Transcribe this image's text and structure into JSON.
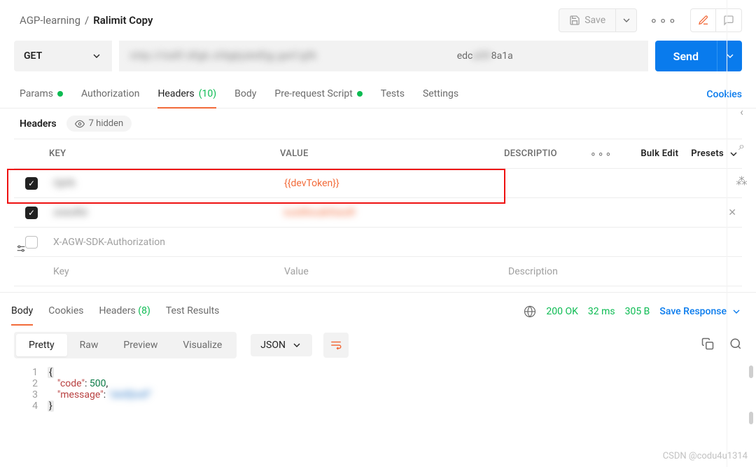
{
  "breadcrumb": {
    "workspace": "AGP-learning",
    "sep": "/",
    "request": "Ralimit Copy"
  },
  "top": {
    "save": "Save"
  },
  "request": {
    "method": "GET",
    "url_obscured_prefix": "nttp://lsdlf.dfgk.sfdgkjskdfjg.gwf/gfk",
    "url_clear_mid": "edc",
    "url_obscured_suffix": "a59",
    "url_clear_tail": "8a1a",
    "send": "Send"
  },
  "tabs": {
    "params": "Params",
    "authorization": "Authorization",
    "headers_label": "Headers",
    "headers_count": "(10)",
    "body": "Body",
    "pre_request": "Pre-request Script",
    "tests": "Tests",
    "settings": "Settings",
    "cookies": "Cookies"
  },
  "headers_sub": {
    "label": "Headers",
    "hidden": "7 hidden"
  },
  "grid_head": {
    "key": "KEY",
    "value": "VALUE",
    "description": "DESCRIPTIO",
    "bulk_edit": "Bulk Edit",
    "presets": "Presets"
  },
  "rows": [
    {
      "key_obscured": "Gjkfk",
      "value": "{{devToken}}",
      "checked": true
    },
    {
      "key_obscured": "slskdfld",
      "value_obscured": "ksldfklsdkflskdfl",
      "checked": true,
      "closable": true
    },
    {
      "key": "X-AGW-SDK-Authorization",
      "value": "",
      "checked": false
    }
  ],
  "placeholder_row": {
    "key": "Key",
    "value": "Value",
    "description": "Description"
  },
  "response_tabs": {
    "body": "Body",
    "cookies": "Cookies",
    "headers": "Headers",
    "headers_count": "(8)",
    "test_results": "Test Results"
  },
  "status": {
    "code": "200 OK",
    "time": "32 ms",
    "size": "305 B",
    "save_response": "Save Response"
  },
  "view": {
    "pretty": "Pretty",
    "raw": "Raw",
    "preview": "Preview",
    "visualize": "Visualize",
    "format": "JSON"
  },
  "code": {
    "lines": [
      "1",
      "2",
      "3",
      "4"
    ],
    "brace_open": "{",
    "entry1_key": "\"code\"",
    "entry1_colon": ": ",
    "entry1_val": "500",
    "comma": ",",
    "entry2_key": "\"message\"",
    "entry2_colon": ": ",
    "entry2_val_obscured": "\"skdfjlsdf\"",
    "brace_close": "}"
  },
  "watermark": "CSDN @codu4u1314"
}
